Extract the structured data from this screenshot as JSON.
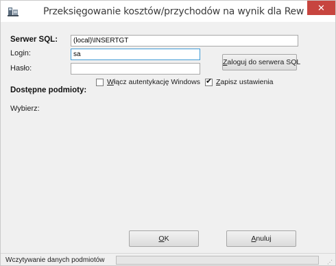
{
  "window": {
    "title": "Przeksięgowanie kosztów/przychodów na wynik dla Rew GT - Logowanie",
    "close_glyph": "✕"
  },
  "form": {
    "server_label": "Serwer SQL:",
    "server_value": "(local)\\INSERTGT",
    "login_label": "Login:",
    "login_value": "sa",
    "password_label": "Hasło:",
    "password_value": "",
    "connect_button": {
      "prefix": "",
      "accel": "Z",
      "suffix": "aloguj do serwera SQL"
    },
    "windows_auth": {
      "prefix": "",
      "accel": "W",
      "suffix": "łącz autentykację Windows",
      "checked": false
    },
    "save_settings": {
      "prefix": "",
      "accel": "Z",
      "suffix": "apisz ustawienia",
      "checked": true
    },
    "entities_heading": "Dostępne podmioty:",
    "choose_label": "Wybierz:"
  },
  "buttons": {
    "ok": {
      "prefix": "",
      "accel": "O",
      "suffix": "K"
    },
    "cancel": {
      "prefix": "",
      "accel": "A",
      "suffix": "nuluj"
    }
  },
  "status": {
    "text": "Wczytywanie danych podmiotów",
    "progress": 0
  },
  "icons": {
    "app": "app-window-icon",
    "close": "close-icon",
    "check": "checkmark-icon",
    "grip": "resize-grip-icon"
  },
  "colors": {
    "close_button": "#c7453f",
    "progress_fill": "#06b025",
    "focus_border": "#3f9ad6"
  }
}
